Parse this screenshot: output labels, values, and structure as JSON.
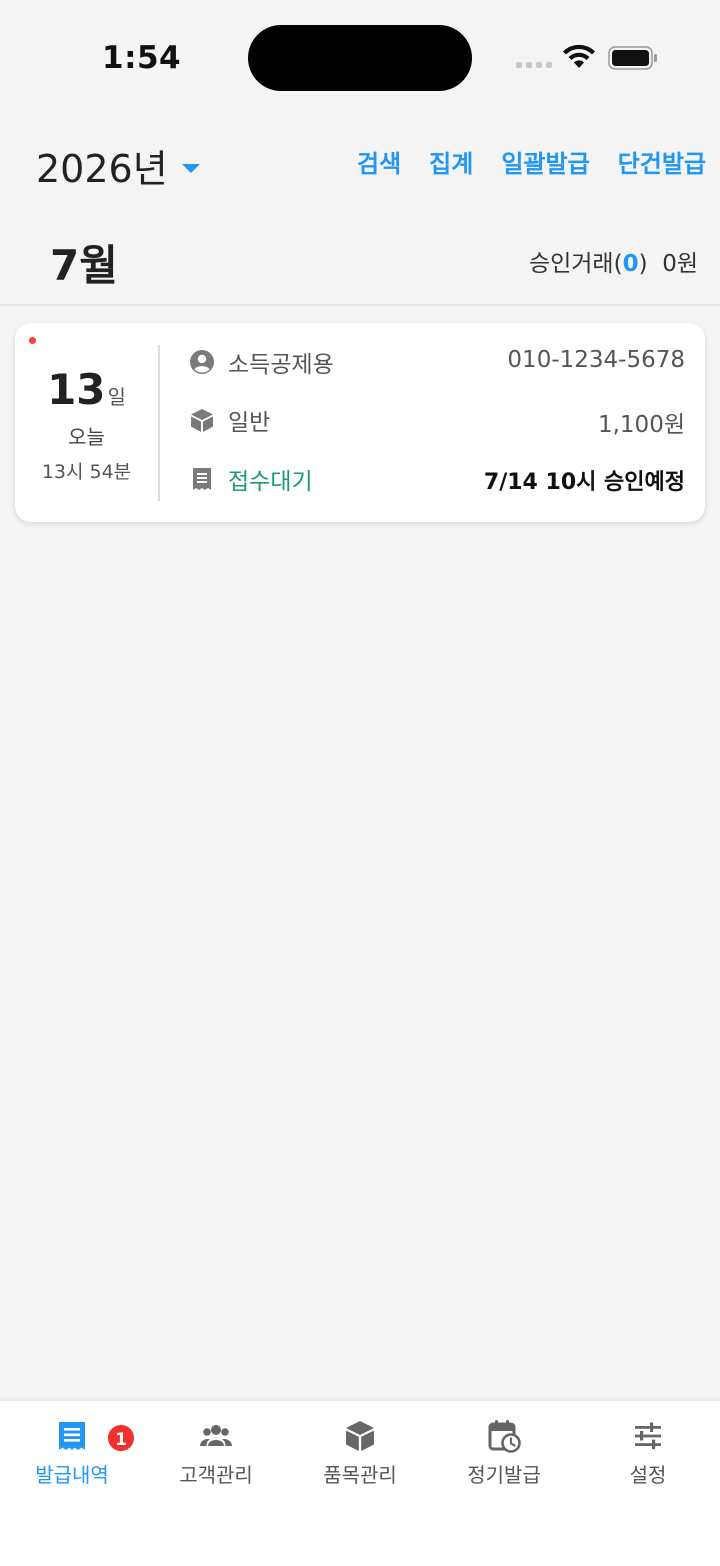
{
  "status_bar": {
    "time": "1:54"
  },
  "header": {
    "year": "2026년",
    "actions": [
      "검색",
      "집계",
      "일괄발급",
      "단건발급"
    ]
  },
  "month": {
    "title": "7월",
    "approved_label_prefix": "승인거래(",
    "approved_count": "0",
    "approved_label_suffix": ")",
    "approved_amount": "0원"
  },
  "receipt": {
    "day": "13",
    "day_unit": "일",
    "relative_day": "오늘",
    "time": "13시 54분",
    "purpose": "소득공제용",
    "phone": "010-1234-5678",
    "item_type": "일반",
    "amount": "1,100원",
    "status": "접수대기",
    "scheduled": "7/14 10시 승인예정"
  },
  "bottom_nav": {
    "items": [
      {
        "label": "발급내역",
        "icon": "receipt-icon",
        "active": true,
        "badge": "1"
      },
      {
        "label": "고객관리",
        "icon": "people-icon"
      },
      {
        "label": "품목관리",
        "icon": "box-icon"
      },
      {
        "label": "정기발급",
        "icon": "calendar-clock-icon"
      },
      {
        "label": "설정",
        "icon": "sliders-icon"
      }
    ]
  },
  "colors": {
    "accent": "#2196f3",
    "status_green": "#1a9a7a",
    "badge_red": "#f0312f"
  }
}
